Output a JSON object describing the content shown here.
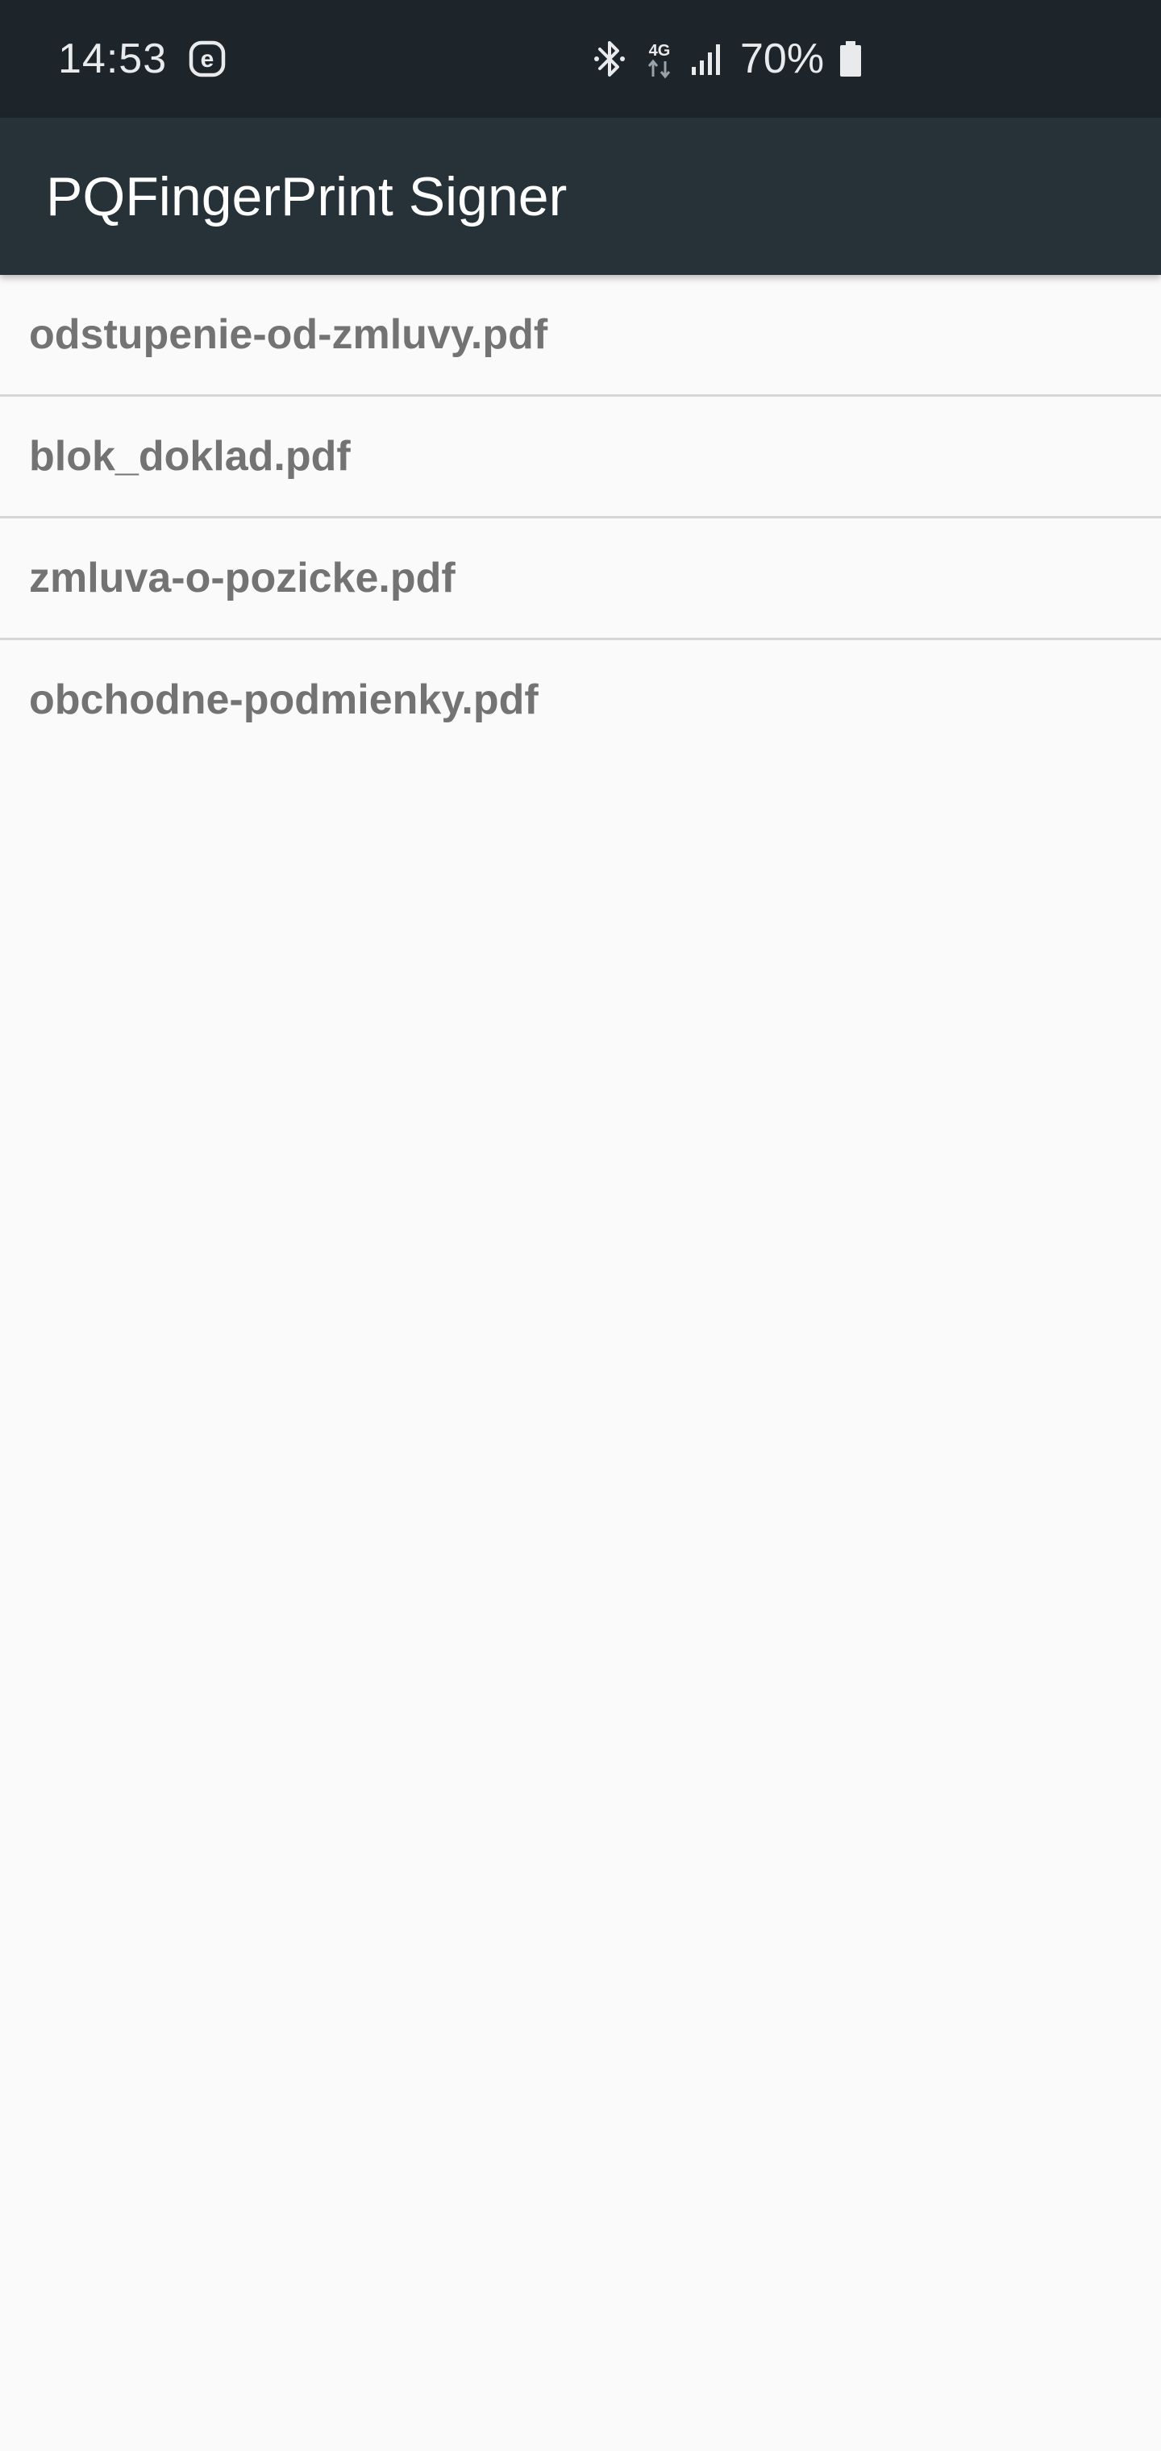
{
  "status_bar": {
    "time": "14:53",
    "notification_icon": "e-circle-icon",
    "bluetooth_icon": "bluetooth-icon",
    "network_type": "4G",
    "network_icon": "data-arrows-icon",
    "signal_icon": "signal-bars-icon",
    "battery_percent": "70%",
    "battery_icon": "battery-icon"
  },
  "app_bar": {
    "title": "PQFingerPrint Signer"
  },
  "files": [
    {
      "name": "odstupenie-od-zmluvy.pdf"
    },
    {
      "name": "blok_doklad.pdf"
    },
    {
      "name": "zmluva-o-pozicke.pdf"
    },
    {
      "name": "obchodne-podmienky.pdf"
    }
  ],
  "colors": {
    "status_bar_bg": "#1d252b",
    "app_bar_bg": "#263238",
    "list_bg": "#fafafa",
    "item_text": "#737373",
    "divider": "#d6d6d6"
  }
}
